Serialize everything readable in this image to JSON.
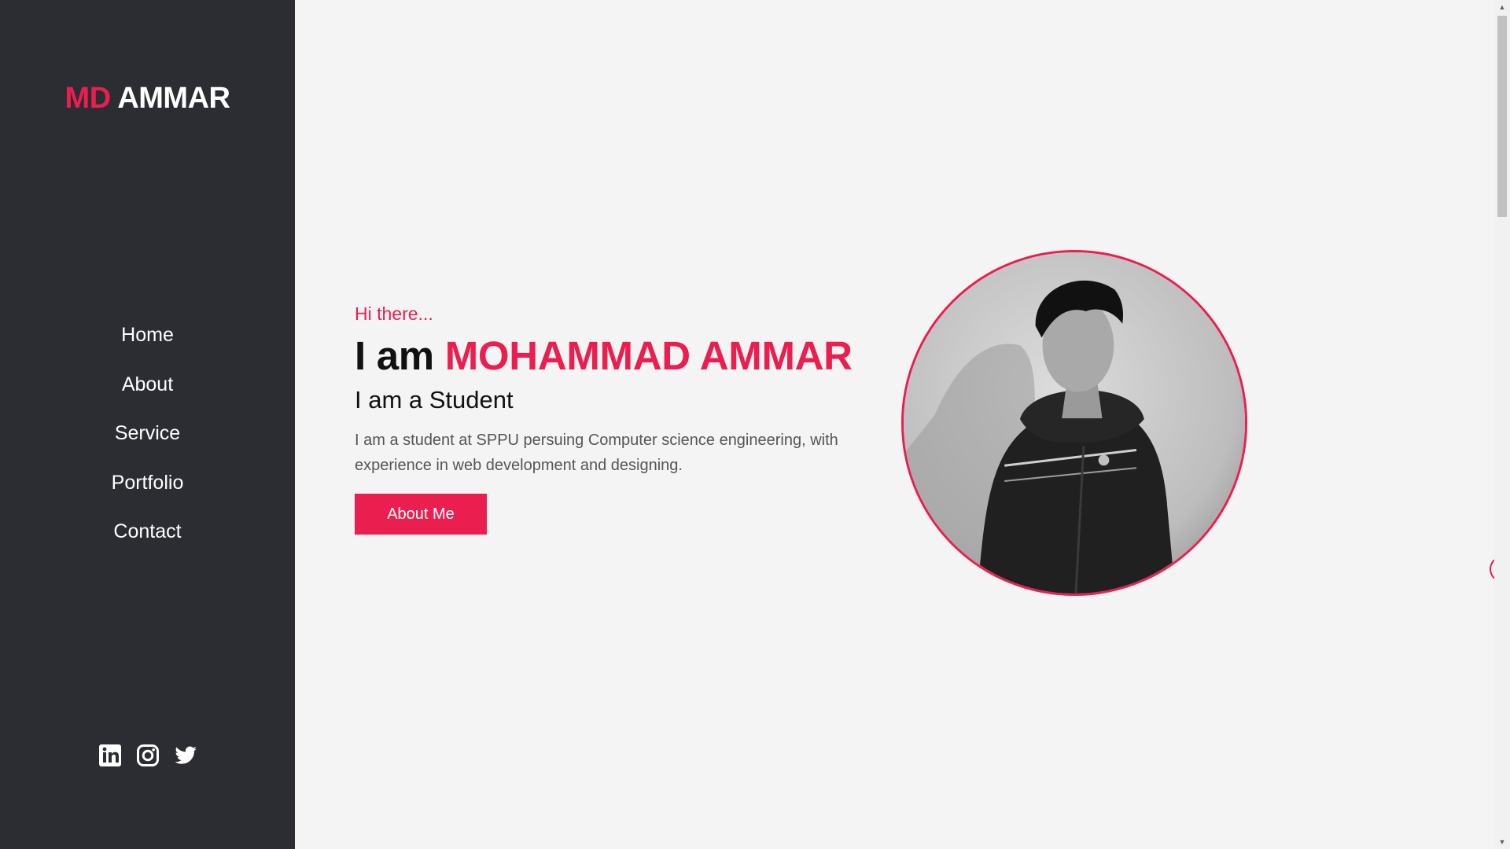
{
  "sidebar": {
    "logo_accent": "MD",
    "logo_rest": "AMMAR",
    "nav": [
      {
        "label": "Home"
      },
      {
        "label": "About"
      },
      {
        "label": "Service"
      },
      {
        "label": "Portfolio"
      },
      {
        "label": "Contact"
      }
    ],
    "socials": [
      "linkedin-icon",
      "instagram-icon",
      "twitter-icon"
    ]
  },
  "hero": {
    "greeting": "Hi there...",
    "title_prefix": "I am",
    "name": "MOHAMMAD AMMAR",
    "subtitle": "I am a Student",
    "description": "I am a student at SPPU persuing Computer science engineering, with experience in web development and designing.",
    "button_label": "About Me"
  },
  "colors": {
    "accent": "#ea1e4f",
    "sidebar_bg": "#2b2d33",
    "main_bg": "#f4f4f4"
  }
}
